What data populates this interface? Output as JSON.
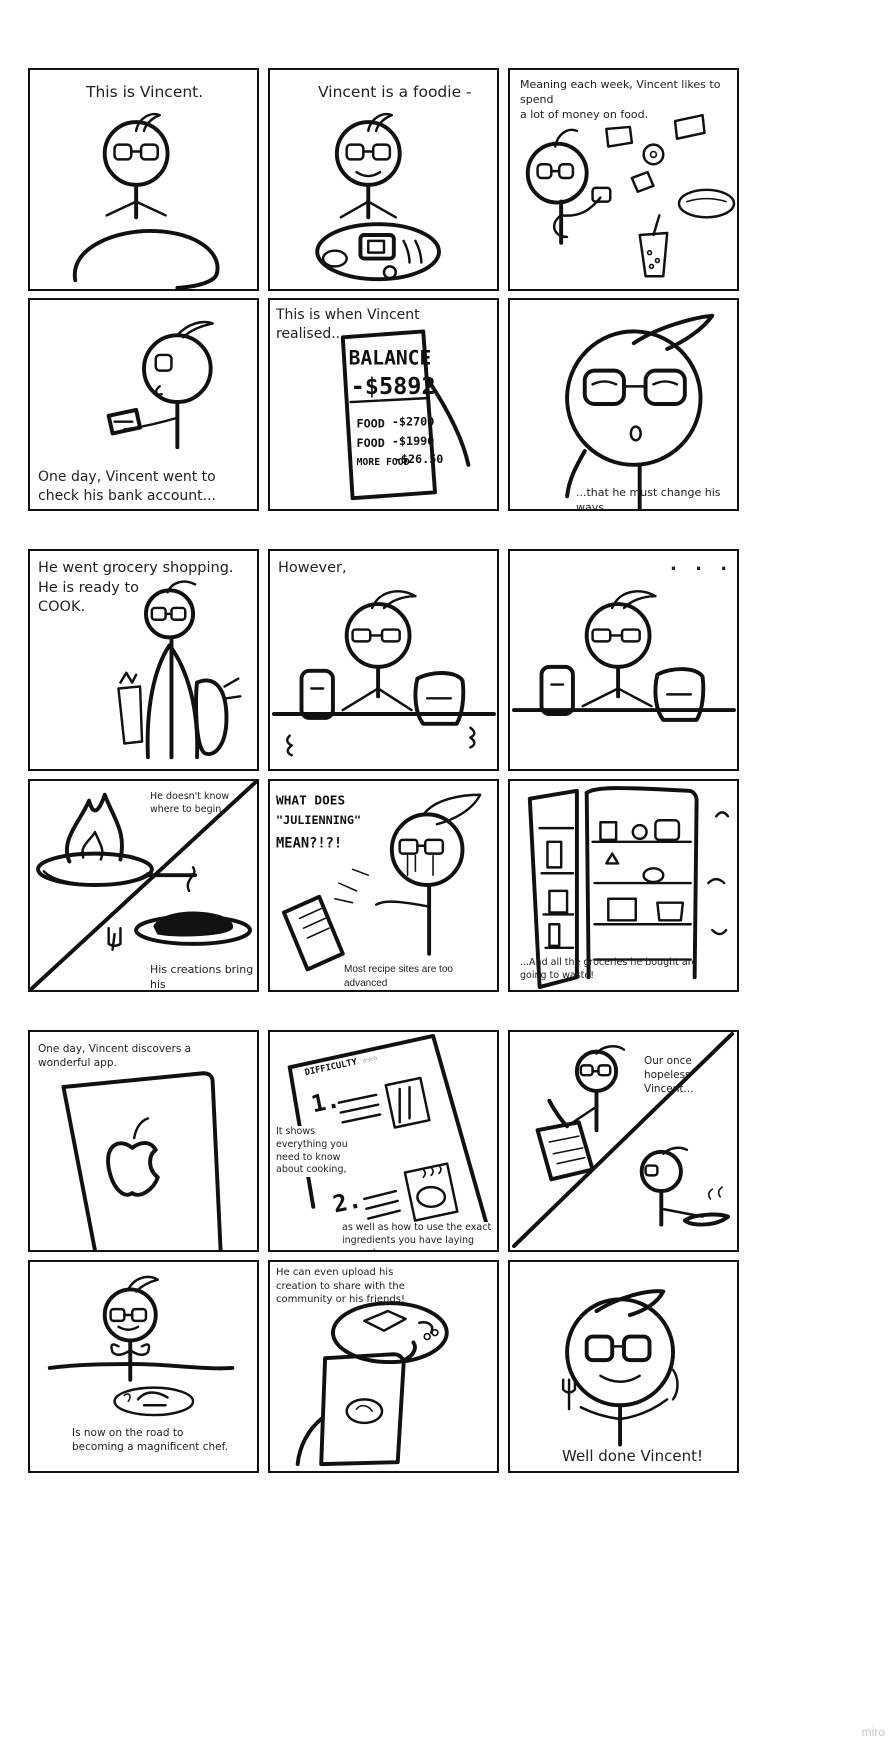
{
  "panels": {
    "p1": {
      "caption": "This is Vincent."
    },
    "p2": {
      "caption": "Vincent is a foodie -"
    },
    "p3": {
      "caption": "Meaning each week, Vincent likes to spend\na lot of money on food."
    },
    "p4": {
      "caption": "One day, Vincent went to\ncheck his bank account..."
    },
    "p5": {
      "caption": "This is when Vincent realised....",
      "phone": {
        "balance_label": "BALANCE",
        "balance_value": "-$5892",
        "rows": [
          {
            "label": "FOOD",
            "value": "-$2700"
          },
          {
            "label": "FOOD",
            "value": "-$1990"
          },
          {
            "label": "MORE\nFOOD",
            "value": "-$26.50"
          }
        ]
      }
    },
    "p6": {
      "caption": "...that he must change his ways."
    },
    "p7": {
      "caption": "He went grocery shopping.\nHe is ready to\nCOOK."
    },
    "p8": {
      "caption": "However,"
    },
    "p9": {
      "caption": ". . ."
    },
    "p10": {
      "caption_top": "He doesn't know\nwhere to begin.",
      "caption_bottom": "His creations bring his\nfoodie soul to shame."
    },
    "p11": {
      "handwritten": "WHAT DOES\n\"JULIENNING\"\nMEAN?!?!",
      "caption": "Most recipe sites are too advanced\nfor poor Vincent to follow."
    },
    "p12": {
      "caption": "...And all the groceries he bought are\ngoing to waste!"
    },
    "p13": {
      "caption": "One day, Vincent discovers a\nwonderful app."
    },
    "p14": {
      "header": "DIFFICULTY ☆☆☆",
      "step1": "1.",
      "step2": "2.",
      "caption_mid": "It shows\neverything you\nneed to know\nabout cooking,",
      "caption_bottom": "as well as how to use the exact\ningredients you have laying around."
    },
    "p15": {
      "caption": "Our once\nhopeless Vincent..."
    },
    "p16": {
      "caption": "Is now on the road to\nbecoming a magnificent chef."
    },
    "p17": {
      "caption": "He can even upload his\ncreation to share with the\ncommunity or his friends!"
    },
    "p18": {
      "caption": "Well done Vincent!"
    }
  },
  "watermark": "miro"
}
